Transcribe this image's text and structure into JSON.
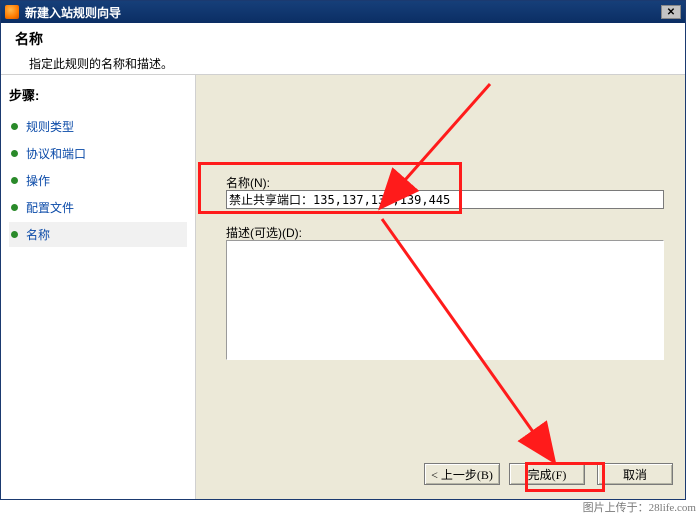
{
  "titlebar": {
    "title": "新建入站规则向导"
  },
  "header": {
    "title": "名称",
    "subtitle": "指定此规则的名称和描述。"
  },
  "sidebar": {
    "stepsTitle": "步骤:",
    "items": [
      {
        "label": "规则类型"
      },
      {
        "label": "协议和端口"
      },
      {
        "label": "操作"
      },
      {
        "label": "配置文件"
      },
      {
        "label": "名称"
      }
    ]
  },
  "form": {
    "nameLabel": "名称(N):",
    "nameValue": "禁止共享端口：135,137,138,139,445",
    "descLabel": "描述(可选)(D):",
    "descValue": ""
  },
  "buttons": {
    "back": "< 上一步(B)",
    "finish": "完成(F)",
    "cancel": "取消"
  },
  "watermark": "图片上传于：28life.com"
}
